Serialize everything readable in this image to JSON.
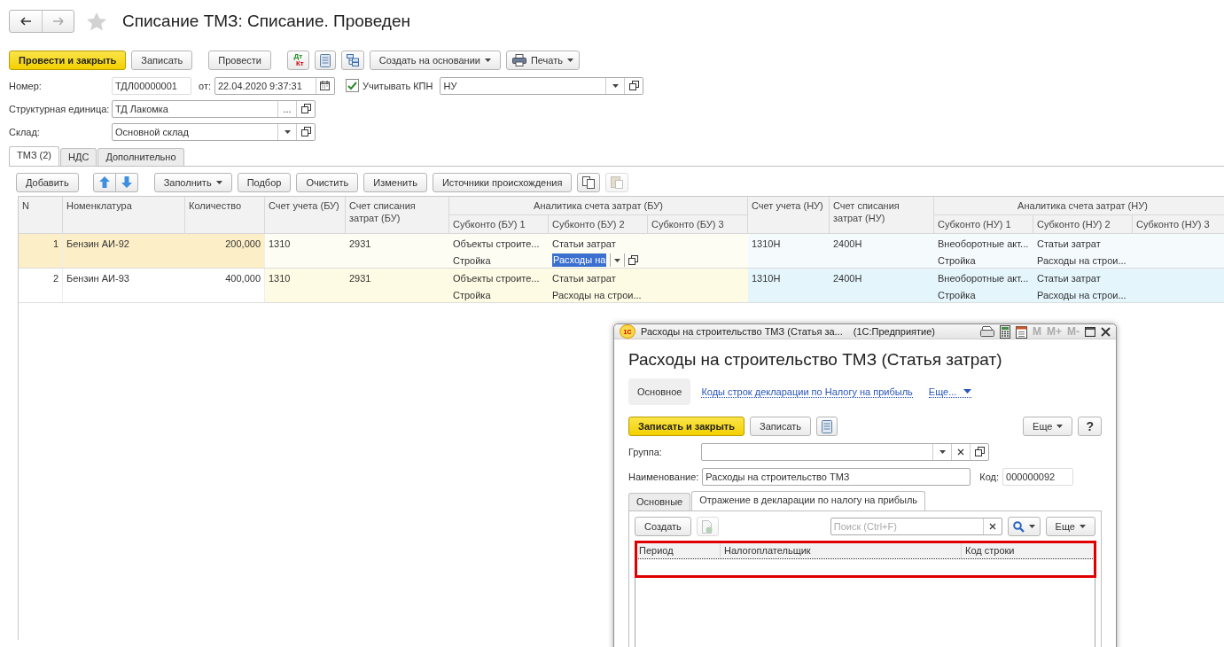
{
  "header": {
    "title": "Списание ТМЗ: Списание. Проведен",
    "favorite": false
  },
  "toolbar": {
    "primary": "Провести и закрыть",
    "buttons": [
      "Записать",
      "Провести"
    ],
    "dtkt": [
      "Дт",
      "Кт"
    ],
    "create_based": "Создать на основании",
    "print": "Печать"
  },
  "fields": {
    "number_label": "Номер:",
    "number": "ТДЛ00000001",
    "date_label": "от:",
    "date": "22.04.2020  9:37:31",
    "kpn": {
      "label": "Учитывать КПН",
      "checked": true
    },
    "mode": "НУ",
    "unit_label": "Структурная единица:",
    "unit": "ТД Лакомка",
    "unit_choose": "...",
    "warehouse_label": "Склад:",
    "warehouse": "Основной склад"
  },
  "tabs": [
    {
      "label": "ТМЗ (2)",
      "selected": true
    },
    {
      "label": "НДС",
      "selected": false
    },
    {
      "label": "Дополнительно",
      "selected": false
    }
  ],
  "table_toolbar": {
    "add": "Добавить",
    "fill": "Заполнить",
    "buttons": [
      "Подбор",
      "Очистить",
      "Изменить",
      "Источники происхождения"
    ]
  },
  "table": {
    "columns": {
      "n": "N",
      "name": "Номенклатура",
      "qty": "Количество",
      "acc_bu": "Счет учета (БУ)",
      "wo_bu": "Счет списания затрат (БУ)",
      "group_bu": "Аналитика счета затрат (БУ)",
      "sub_bu": [
        "Субконто (БУ) 1",
        "Субконто (БУ) 2",
        "Субконто (БУ) 3"
      ],
      "acc_nu": "Счет учета (НУ)",
      "wo_nu": "Счет списания затрат (НУ)",
      "group_nu": "Аналитика счета затрат (НУ)",
      "sub_nu": [
        "Субконто (НУ) 1",
        "Субконто (НУ) 2",
        "Субконто (НУ) 3"
      ]
    },
    "rows": [
      {
        "n": "1",
        "name": "Бензин АИ-92",
        "qty": "200,000",
        "acc_bu": "1310",
        "wo_bu": "2931",
        "sub_bu": [
          [
            "Объекты строите...",
            "Стройка"
          ],
          [
            "Статьи затрат",
            "Расходы на"
          ]
        ],
        "acc_nu": "1310Н",
        "wo_nu": "2400Н",
        "sub_nu": [
          [
            "Внеоборотные акт...",
            "Стройка"
          ],
          [
            "Статьи затрат",
            "Расходы на строи..."
          ]
        ],
        "selected": true,
        "editing": true
      },
      {
        "n": "2",
        "name": "Бензин АИ-93",
        "qty": "400,000",
        "acc_bu": "1310",
        "wo_bu": "2931",
        "sub_bu": [
          [
            "Объекты строите...",
            "Стройка"
          ],
          [
            "Статьи затрат",
            "Расходы на строи..."
          ]
        ],
        "acc_nu": "1310Н",
        "wo_nu": "2400Н",
        "sub_nu": [
          [
            "Внеоборотные акт...",
            "Стройка"
          ],
          [
            "Статьи затрат",
            "Расходы на строи..."
          ]
        ],
        "selected": false,
        "editing": false
      }
    ]
  },
  "dialog": {
    "logo": "1С",
    "title": "Расходы на строительство ТМЗ (Статья за...",
    "app": "(1С:Предприятие)",
    "mem": [
      "M",
      "M+",
      "M-"
    ],
    "heading": "Расходы на строительство ТМЗ (Статья затрат)",
    "nav": [
      {
        "label": "Основное",
        "selected": true
      },
      {
        "label": "Коды строк декларации по Налогу на прибыль",
        "selected": false
      }
    ],
    "more_link": "Еще...",
    "save_close": "Записать и закрыть",
    "save": "Записать",
    "more": "Еще",
    "help": "?",
    "group_label": "Группа:",
    "name_label": "Наименование:",
    "name": "Расходы на строительство ТМЗ",
    "code_label": "Код:",
    "code": "000000092",
    "tabs": [
      {
        "label": "Основные",
        "selected": false
      },
      {
        "label": "Отражение в декларации по налогу на прибыль",
        "selected": true
      }
    ],
    "create": "Создать",
    "search_placeholder": "Поиск (Ctrl+F)",
    "list_more": "Еще",
    "columns": [
      "Период",
      "Налогоплательщик",
      "Код строки"
    ]
  }
}
